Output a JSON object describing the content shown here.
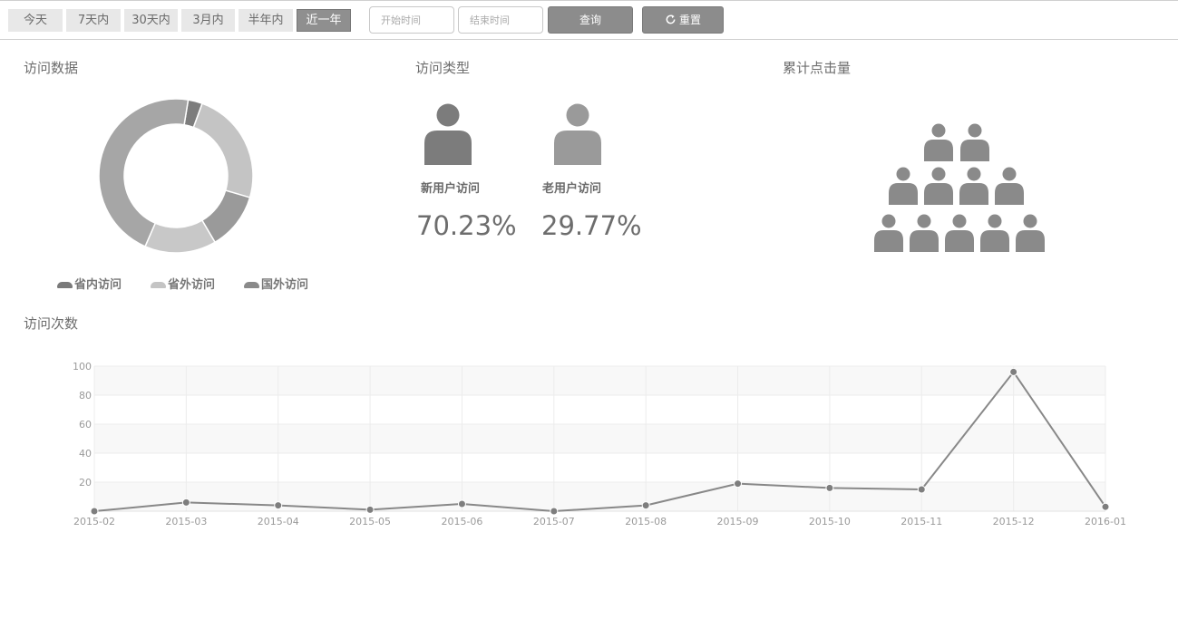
{
  "toolbar": {
    "ranges": [
      "今天",
      "7天内",
      "30天内",
      "3月内",
      "半年内",
      "近一年"
    ],
    "active_range": "近一年",
    "start_placeholder": "开始时间",
    "end_placeholder": "结束时间",
    "query_label": "查询",
    "reset_label": "重置",
    "reset_icon": "refresh-icon"
  },
  "visit_data": {
    "title": "访问数据",
    "legend": [
      "省内访问",
      "省外访问",
      "国外访问"
    ],
    "colors": {
      "province": "#8a8a8a",
      "out_province": "#c4c4c4",
      "abroad": "#9a9a9a"
    }
  },
  "visit_type": {
    "title": "访问类型",
    "new_label": "新用户访问",
    "new_pct": "70.23%",
    "old_label": "老用户访问",
    "old_pct": "29.77%"
  },
  "clicks": {
    "title": "累计点击量",
    "icon": "users-group-icon"
  },
  "visit_count": {
    "title": "访问次数"
  },
  "chart_data": [
    {
      "type": "pie",
      "donut": true,
      "slices": [
        {
          "label": "",
          "value": 3,
          "color": "#7d7d7d"
        },
        {
          "label": "",
          "value": 24,
          "color": "#c4c4c4"
        },
        {
          "label": "",
          "value": 12,
          "color": "#9a9a9a"
        },
        {
          "label": "",
          "value": 15,
          "color": "#c8c8c8"
        },
        {
          "label": "",
          "value": 46,
          "color": "#a6a6a6"
        }
      ]
    },
    {
      "type": "line",
      "categories": [
        "2015-02",
        "2015-03",
        "2015-04",
        "2015-05",
        "2015-06",
        "2015-07",
        "2015-08",
        "2015-09",
        "2015-10",
        "2015-11",
        "2015-12",
        "2016-01"
      ],
      "values": [
        0,
        6,
        4,
        1,
        5,
        0,
        4,
        19,
        16,
        15,
        96,
        3
      ],
      "ylim": [
        0,
        100
      ],
      "yticks": [
        20,
        40,
        60,
        80,
        100
      ],
      "grid": true,
      "color": "#888888",
      "title": "",
      "xlabel": "",
      "ylabel": ""
    }
  ]
}
